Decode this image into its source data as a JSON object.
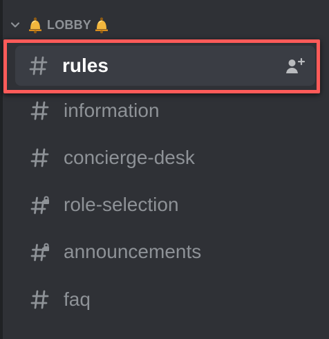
{
  "category": {
    "label": "LOBBY",
    "left_icon": "bell-icon",
    "right_icon": "bell-icon",
    "collapse_icon": "chevron-down-icon"
  },
  "channels": [
    {
      "name": "rules",
      "icon": "hash-icon",
      "active": true,
      "action_icon": "invite-user-icon"
    },
    {
      "name": "information",
      "icon": "hash-icon",
      "active": false
    },
    {
      "name": "concierge-desk",
      "icon": "hash-icon",
      "active": false
    },
    {
      "name": "role-selection",
      "icon": "locked-hash-icon",
      "active": false
    },
    {
      "name": "announcements",
      "icon": "locked-hash-icon",
      "active": false
    },
    {
      "name": "faq",
      "icon": "hash-icon",
      "active": false
    }
  ],
  "colors": {
    "sidebar_background": "#2f3136",
    "active_channel_background": "#3a3d44",
    "muted_text": "#8e9297",
    "active_text": "#ffffff",
    "highlight_border": "#ff5b59",
    "bell": "#f2b63d"
  }
}
